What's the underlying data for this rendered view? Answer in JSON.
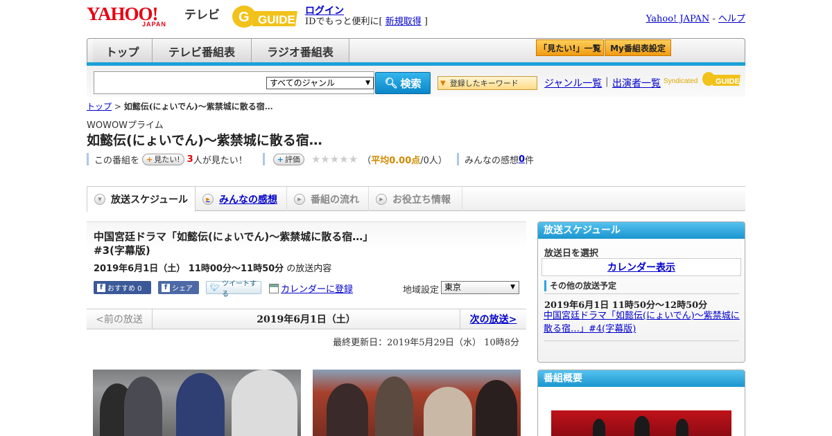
{
  "header": {
    "logo_yahoo": "YAHOO!",
    "logo_japan": "JAPAN",
    "logo_tv": "テレビ",
    "gguide_logo": "G-GUIDE",
    "login": "ログイン",
    "login_sub_prefix": "IDでもっと便利に[ ",
    "register": "新規取得",
    "login_sub_suffix": " ]",
    "yahoo_japan_link": "Yahoo! JAPAN",
    "sep": " - ",
    "help_link": "ヘルプ"
  },
  "nav": {
    "tabs": [
      "トップ",
      "テレビ番組表",
      "ラジオ番組表"
    ],
    "wish_list": "「見たい!」一覧",
    "my_schedule": "My番組表設定"
  },
  "search": {
    "placeholder": "",
    "genre_selected": "すべてのジャンル",
    "search_button": "検索",
    "keyword_button": "登録したキーワード",
    "genre_list": "ジャンル一覧",
    "separator": "|",
    "performer_list": "出演者一覧",
    "syndicated": "Syndicated",
    "synd_logo": "G-GUIDE"
  },
  "breadcrumb": {
    "home": "トップ",
    "sep": " > ",
    "current": "如懿伝(にょいでん)～紫禁城に散る宿…"
  },
  "program": {
    "channel": "WOWOWプライム",
    "title": "如懿伝(にょいでん)～紫禁城に散る宿…",
    "stats_prefix": "この番組を",
    "want_button": "見たい!",
    "want_count": "3",
    "want_suffix": "人が見たい！",
    "rate_button": "評価",
    "stars": "★★★★★",
    "rating_open": "（",
    "rating_avg": "平均0.00点",
    "rating_count": "/0人）",
    "impressions_label": "みんなの感想 ",
    "impressions_count": "0",
    "impressions_suffix": "件"
  },
  "content_tabs": [
    "放送スケジュール",
    "みんなの感想",
    "番組の流れ",
    "お役立ち情報"
  ],
  "broadcast": {
    "full_title": "中国宮廷ドラマ「如懿伝(にょいでん)～紫禁城に散る宿…」#3(字幕版)",
    "date_time": "2019年6月1日（土） 11時00分～11時50分",
    "date_suffix": " の放送内容",
    "fb_recommend": "おすすめ 0",
    "fb_share": "シェア",
    "tweet": "ツイートする",
    "calendar_register": "カレンダーに登録",
    "region_label": "地域設定",
    "region_selected": "東京",
    "prev": "<前の放送",
    "current_date": "2019年6月1日（土）",
    "next": "次の放送>",
    "updated": "最終更新日：2019年5月29日（水） 10時8分"
  },
  "sidebar": {
    "schedule_heading": "放送スケジュール",
    "pick_date": "放送日を選択",
    "calendar_show": "カレンダー表示",
    "other_heading": "その他の放送予定",
    "other_date": "2019年6月1日 11時50分～12時50分",
    "other_link": "中国宮廷ドラマ「如懿伝(にょいでん)～紫禁城に散る宿…」#4(字幕版)",
    "overview_heading": "番組概要"
  },
  "colors": {
    "accent_blue": "#1aa0da",
    "yahoo_red": "#e60012",
    "link": "#0000cc",
    "nav_orange": "#f09b12"
  }
}
